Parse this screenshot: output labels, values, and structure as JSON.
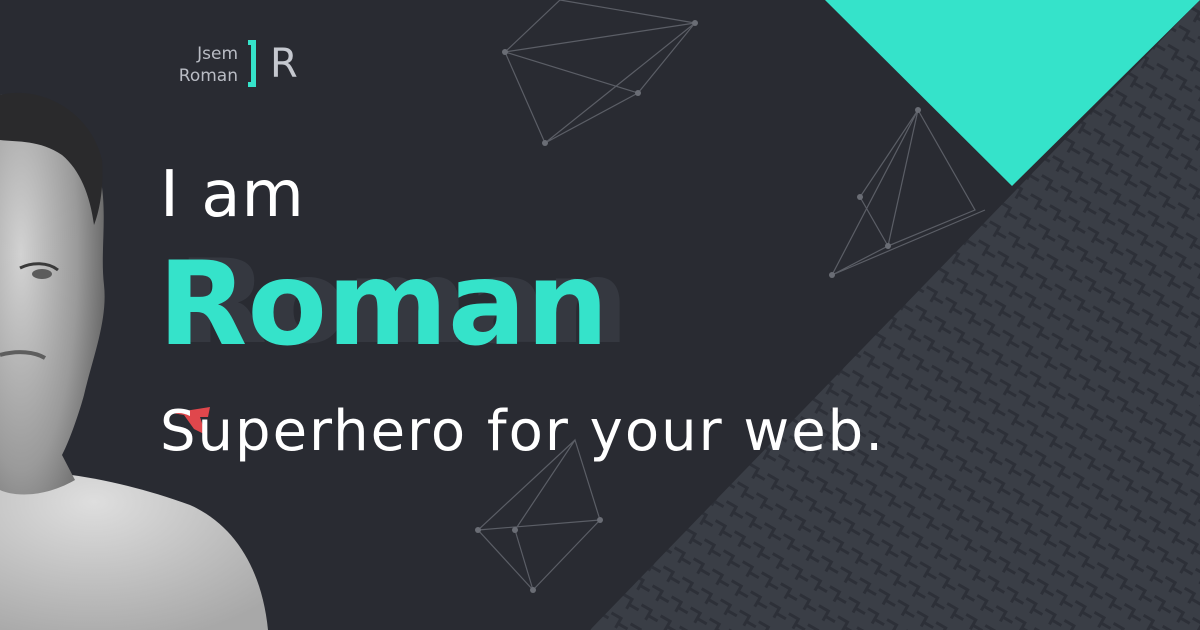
{
  "logo": {
    "line1": "Jsem",
    "line2": "Roman",
    "letter": "R"
  },
  "hero": {
    "intro": "I am",
    "name": "Roman",
    "tagline": "Superhero for your web."
  },
  "colors": {
    "background": "#292b32",
    "accent": "#35e3ca",
    "pattern": "#3c4048",
    "cape": "#e0474c"
  },
  "icons": [
    "cape-icon",
    "portrait",
    "network-lines"
  ]
}
